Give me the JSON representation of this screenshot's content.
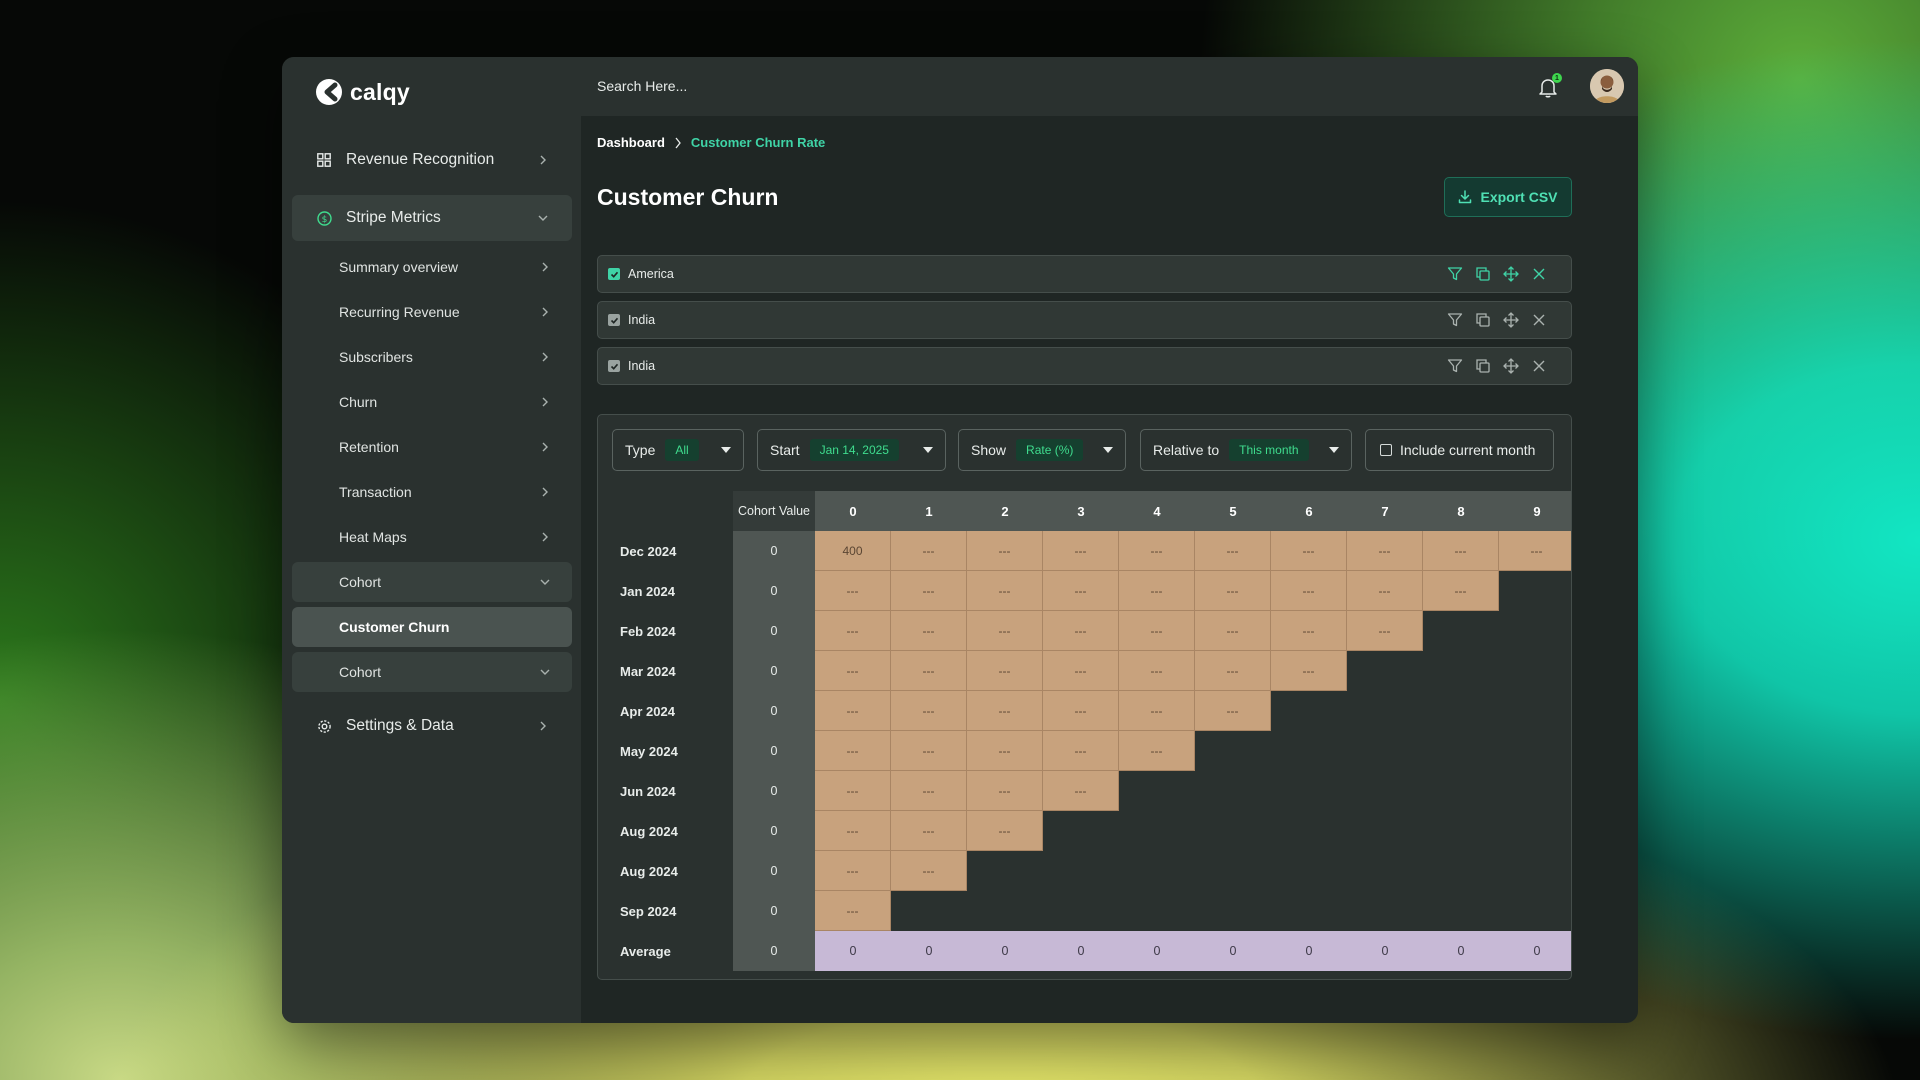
{
  "brand": {
    "name": "calqy"
  },
  "colors": {
    "accent": "#3fd3a6",
    "cell_fill": "#c8a27d",
    "average_fill": "#c7b9d6",
    "sidebar_bg": "#2a312f"
  },
  "sidebar": {
    "revenue_recognition": "Revenue Recognition",
    "stripe_metrics": "Stripe Metrics",
    "items": [
      "Summary overview",
      "Recurring Revenue",
      "Subscribers",
      "Churn",
      "Retention",
      "Transaction",
      "Heat Maps"
    ],
    "cohort_group": "Cohort",
    "current": "Customer Churn",
    "cohort_group_2": "Cohort",
    "settings": "Settings & Data"
  },
  "topbar": {
    "search_placeholder": "Search Here...",
    "notifications": "1"
  },
  "breadcrumb": {
    "root": "Dashboard",
    "current": "Customer Churn Rate"
  },
  "page": {
    "title": "Customer Churn",
    "export_label": "Export CSV"
  },
  "filters": [
    "America",
    "India",
    "India"
  ],
  "controls": {
    "type_label": "Type",
    "type_value": "All",
    "start_label": "Start",
    "start_value": "Jan 14, 2025",
    "show_label": "Show",
    "show_value": "Rate (%)",
    "relative_label": "Relative to",
    "relative_value": "This month",
    "include_label": "Include current month"
  },
  "table": {
    "cohort_value_header": "Cohort Value",
    "periods": [
      "0",
      "1",
      "2",
      "3",
      "4",
      "5",
      "6",
      "7",
      "8",
      "9"
    ],
    "rows": [
      {
        "label": "Dec 2024",
        "cohort_value": "0",
        "cells": [
          "400",
          "---",
          "---",
          "---",
          "---",
          "---",
          "---",
          "---",
          "---",
          "---"
        ]
      },
      {
        "label": "Jan 2024",
        "cohort_value": "0",
        "cells": [
          "---",
          "---",
          "---",
          "---",
          "---",
          "---",
          "---",
          "---",
          "---"
        ]
      },
      {
        "label": "Feb 2024",
        "cohort_value": "0",
        "cells": [
          "---",
          "---",
          "---",
          "---",
          "---",
          "---",
          "---",
          "---"
        ]
      },
      {
        "label": "Mar 2024",
        "cohort_value": "0",
        "cells": [
          "---",
          "---",
          "---",
          "---",
          "---",
          "---",
          "---"
        ]
      },
      {
        "label": "Apr 2024",
        "cohort_value": "0",
        "cells": [
          "---",
          "---",
          "---",
          "---",
          "---",
          "---"
        ]
      },
      {
        "label": "May 2024",
        "cohort_value": "0",
        "cells": [
          "---",
          "---",
          "---",
          "---",
          "---"
        ]
      },
      {
        "label": "Jun 2024",
        "cohort_value": "0",
        "cells": [
          "---",
          "---",
          "---",
          "---"
        ]
      },
      {
        "label": "Aug 2024",
        "cohort_value": "0",
        "cells": [
          "---",
          "---",
          "---"
        ]
      },
      {
        "label": "Aug 2024",
        "cohort_value": "0",
        "cells": [
          "---",
          "---"
        ]
      },
      {
        "label": "Sep 2024",
        "cohort_value": "0",
        "cells": [
          "---"
        ]
      }
    ],
    "average": {
      "label": "Average",
      "cohort_value": "0",
      "cells": [
        "0",
        "0",
        "0",
        "0",
        "0",
        "0",
        "0",
        "0",
        "0",
        "0"
      ]
    }
  }
}
